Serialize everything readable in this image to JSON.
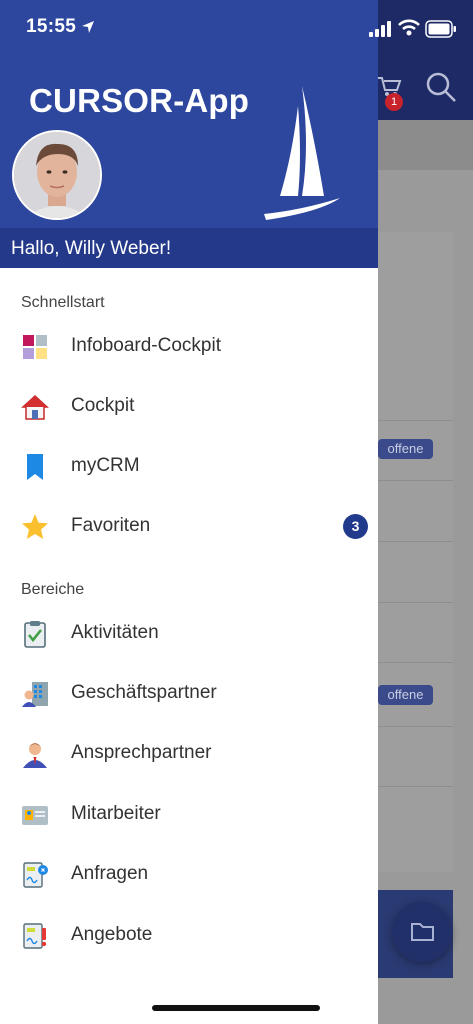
{
  "status_bar": {
    "time": "15:55"
  },
  "background_app": {
    "cart_badge": "1",
    "status_badge_1": "offene",
    "status_badge_2": "offene"
  },
  "drawer": {
    "app_title": "CURSOR-App",
    "greeting": "Hallo, Willy Weber!",
    "sections": [
      {
        "title": "Schnellstart",
        "items": [
          {
            "label": "Infoboard-Cockpit",
            "icon": "grid-tiles-icon"
          },
          {
            "label": "Cockpit",
            "icon": "house-icon"
          },
          {
            "label": "myCRM",
            "icon": "bookmark-icon"
          },
          {
            "label": "Favoriten",
            "icon": "star-icon",
            "badge": "3"
          }
        ]
      },
      {
        "title": "Bereiche",
        "items": [
          {
            "label": "Aktivitäten",
            "icon": "clipboard-check-icon"
          },
          {
            "label": "Geschäftspartner",
            "icon": "business-partner-icon"
          },
          {
            "label": "Ansprechpartner",
            "icon": "contact-person-icon"
          },
          {
            "label": "Mitarbeiter",
            "icon": "employee-card-icon"
          },
          {
            "label": "Anfragen",
            "icon": "inquiry-document-icon"
          },
          {
            "label": "Angebote",
            "icon": "offer-document-icon"
          }
        ]
      }
    ]
  },
  "colors": {
    "drawer_header": "#2e479e",
    "greeting_bar": "#24398a",
    "badge": "#223a8c"
  }
}
